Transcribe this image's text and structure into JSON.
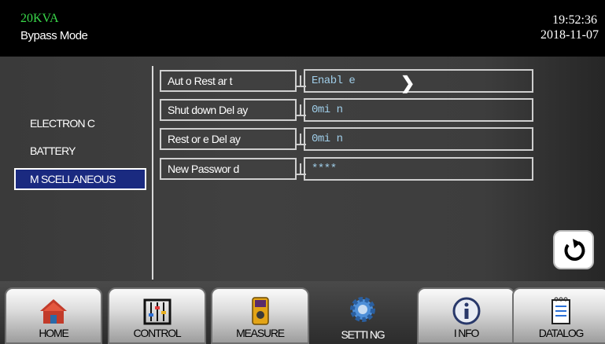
{
  "header": {
    "rating": "20KVA",
    "mode": "Bypass Mode",
    "time": "19:52:36",
    "date": "2018-11-07"
  },
  "categories": [
    "ELECTRON C",
    "BATTERY",
    "M SCELLANEOUS"
  ],
  "selected_category": "M SCELLANEOUS",
  "settings": [
    {
      "label": "Aut o  Rest ar t",
      "value": "Enabl e"
    },
    {
      "label": "Shut down  Del ay",
      "value": "0mi n"
    },
    {
      "label": "Rest or e  Del ay",
      "value": "0mi n"
    },
    {
      "label": "New  Passwor d",
      "value": "****"
    }
  ],
  "nav": [
    {
      "label": "HOME",
      "icon": "home-icon"
    },
    {
      "label": "CONTROL",
      "icon": "control-icon"
    },
    {
      "label": "MEASURE",
      "icon": "measure-icon"
    },
    {
      "label": "SETTI NG",
      "icon": "gear-icon"
    },
    {
      "label": "I NFO",
      "icon": "info-icon"
    },
    {
      "label": "DATALOG",
      "icon": "datalog-icon"
    }
  ],
  "colors": {
    "rating": "#39d84a",
    "value_text": "#9fcde8",
    "selected_bg": "#1a2a80"
  }
}
